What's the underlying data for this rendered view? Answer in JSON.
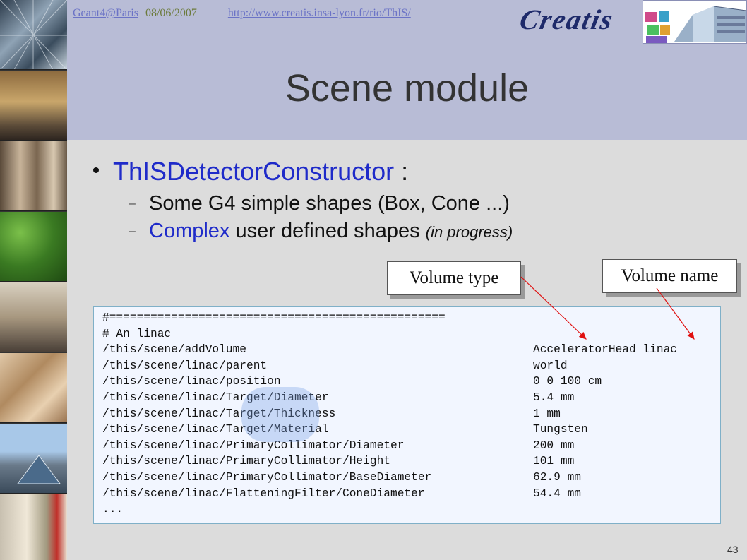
{
  "header": {
    "conference_link": "Geant4@Paris",
    "date": "08/06/2007",
    "url_link": "http://www.creatis.insa-lyon.fr/rio/ThIS/",
    "logo_text": "Creatis"
  },
  "slide": {
    "title": "Scene module",
    "bullet": {
      "highlight": "ThISDetectorConstructor",
      "rest": " :"
    },
    "sub1": "Some G4 simple shapes (Box, Cone ...)",
    "sub2": {
      "highlight": "Complex",
      "rest": " user defined shapes ",
      "note": "(in progress)"
    },
    "label_type": "Volume type",
    "label_name": "Volume name",
    "page_number": "43"
  },
  "code_lines": [
    {
      "cmd": "#=================================================",
      "val": ""
    },
    {
      "cmd": "# An linac",
      "val": ""
    },
    {
      "cmd": "/this/scene/addVolume",
      "val": "AcceleratorHead linac"
    },
    {
      "cmd": "/this/scene/linac/parent",
      "val": "world"
    },
    {
      "cmd": "/this/scene/linac/position",
      "val": "0 0 100 cm"
    },
    {
      "cmd": "/this/scene/linac/Target/Diameter",
      "val": "5.4 mm"
    },
    {
      "cmd": "/this/scene/linac/Target/Thickness",
      "val": "1 mm"
    },
    {
      "cmd": "/this/scene/linac/Target/Material",
      "val": "Tungsten"
    },
    {
      "cmd": "/this/scene/linac/PrimaryCollimator/Diameter",
      "val": "200 mm"
    },
    {
      "cmd": "/this/scene/linac/PrimaryCollimator/Height",
      "val": "101 mm"
    },
    {
      "cmd": "/this/scene/linac/PrimaryCollimator/BaseDiameter",
      "val": "62.9 mm"
    },
    {
      "cmd": "/this/scene/linac/FlatteningFilter/ConeDiameter",
      "val": "54.4 mm"
    },
    {
      "cmd": "...",
      "val": ""
    }
  ],
  "colors": {
    "header_bg": "#b8bcd6",
    "content_bg": "#dcdcdc",
    "accent_blue": "#1f2bc9",
    "arrow_red": "#e01010"
  }
}
